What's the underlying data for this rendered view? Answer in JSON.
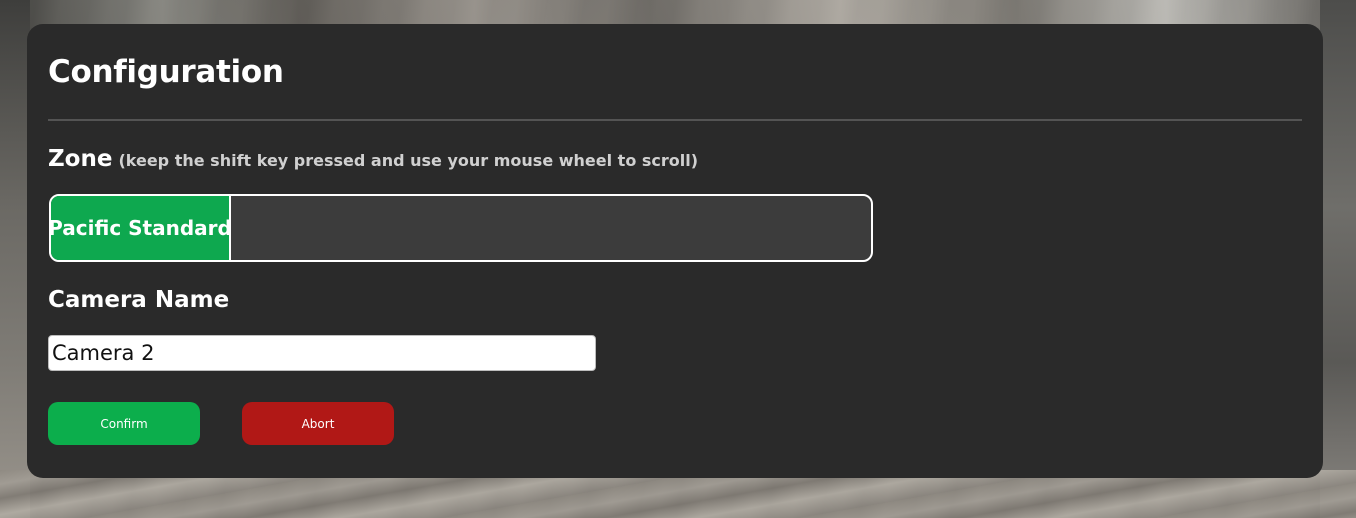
{
  "panel": {
    "title": "Configuration"
  },
  "zone": {
    "label": "Zone",
    "hint": "(keep the shift key pressed and use your mouse wheel to scroll)",
    "options": [
      {
        "label": "Pacific Standard",
        "selected": true
      }
    ],
    "selected_color": "#0ea84f"
  },
  "camera_name": {
    "label": "Camera Name",
    "value": "Camera 2"
  },
  "actions": {
    "confirm_label": "Confirm",
    "abort_label": "Abort",
    "confirm_color": "#0cae4c",
    "abort_color": "#b11816"
  }
}
